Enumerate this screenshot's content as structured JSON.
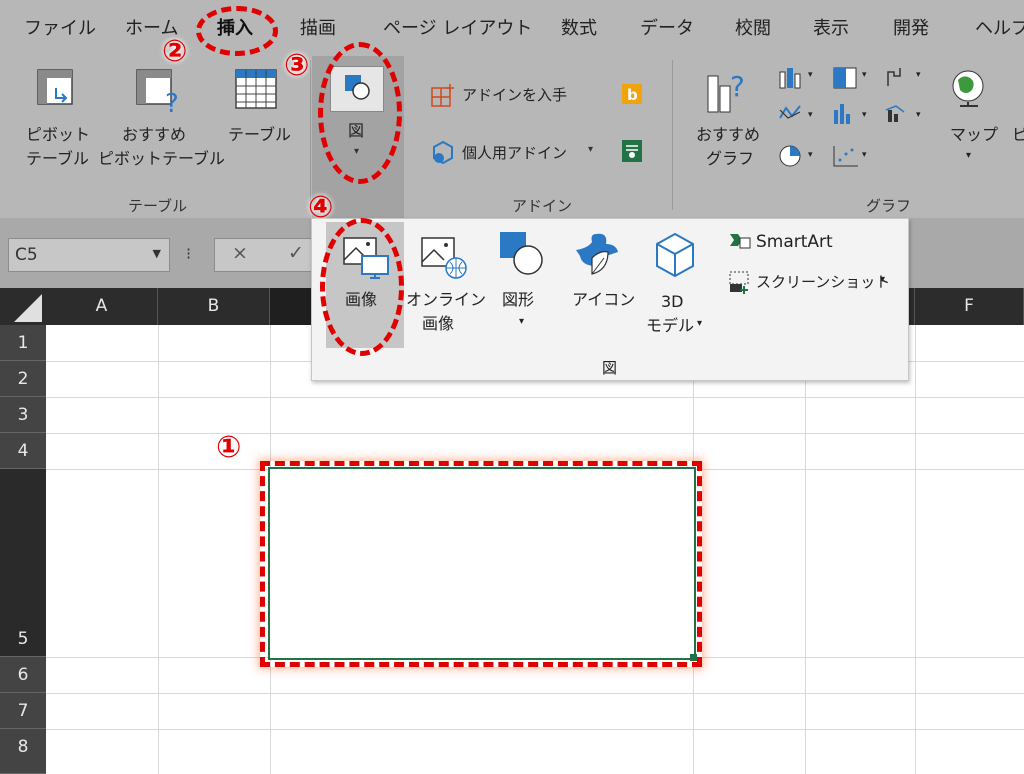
{
  "tabs": [
    "ファイル",
    "ホーム",
    "挿入",
    "描画",
    "ページ レイアウト",
    "数式",
    "データ",
    "校閲",
    "表示",
    "開発",
    "ヘルプ"
  ],
  "ribbon": {
    "pivot_table": [
      "ピボット",
      "テーブル"
    ],
    "recommended_pivot": [
      "おすすめ",
      "ピボットテーブル"
    ],
    "table": "テーブル",
    "illustrations": "図",
    "get_addins": "アドインを入手",
    "my_addins": "個人用アドイン",
    "recommended_charts": [
      "おすすめ",
      "グラフ"
    ],
    "maps": "マップ",
    "pivot_chart_partial": "ピ",
    "groups": {
      "tables": "テーブル",
      "addins": "アドイン",
      "charts": "グラフ"
    }
  },
  "formula_bar": {
    "name_box": "C5",
    "cancel": "×",
    "enter": "✓"
  },
  "dropdown": {
    "pictures": "画像",
    "online_pictures": [
      "オンライン",
      "画像"
    ],
    "shapes": "図形",
    "icons": "アイコン",
    "models_3d": [
      "3D",
      "モデル"
    ],
    "smartart": "SmartArt",
    "screenshot": "スクリーンショット",
    "group_label": "図"
  },
  "columns": [
    "A",
    "B",
    "",
    "",
    "",
    "",
    "F"
  ],
  "rows": [
    "1",
    "2",
    "3",
    "4",
    "5",
    "6",
    "7",
    "8"
  ],
  "annotations": [
    "①",
    "②",
    "③",
    "④"
  ],
  "colors": {
    "annotation": "#e00000",
    "ribbon_bg": "#b8b7b7",
    "header_bg": "#2c2c2c"
  }
}
